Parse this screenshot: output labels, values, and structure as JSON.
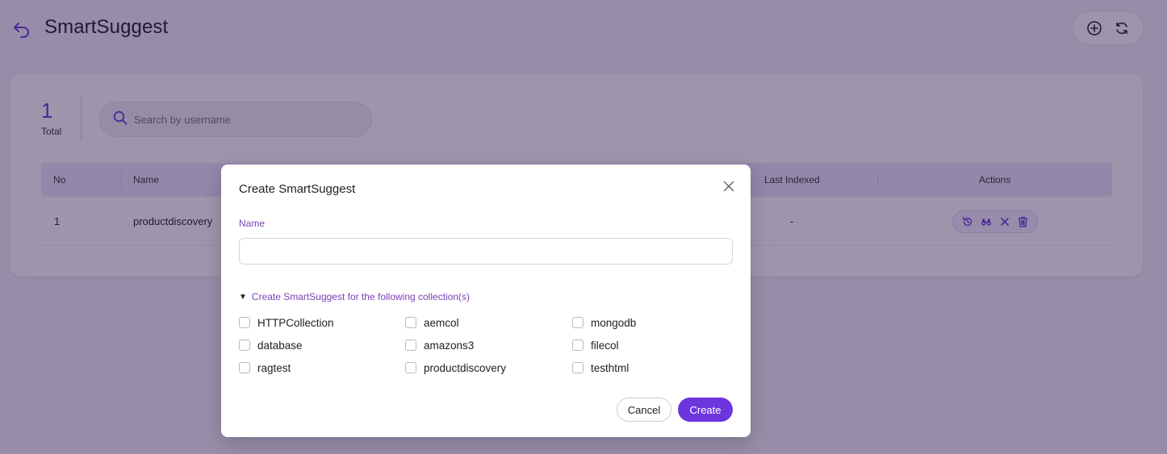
{
  "header": {
    "title": "SmartSuggest",
    "back_icon": "back-arrow-icon",
    "add_icon": "plus-circle-icon",
    "refresh_icon": "refresh-icon"
  },
  "summary": {
    "total_count": "1",
    "total_label": "Total"
  },
  "search": {
    "placeholder": "Search by username",
    "value": ""
  },
  "table": {
    "columns": [
      "No",
      "Name",
      "Last Indexed",
      "Actions"
    ],
    "rows": [
      {
        "no": "1",
        "name": "productdiscovery",
        "last_indexed": "-"
      }
    ],
    "row_action_icons": [
      "reindex-icon",
      "binoculars-icon",
      "close-icon",
      "trash-icon"
    ]
  },
  "modal": {
    "title": "Create SmartSuggest",
    "name_label": "Name",
    "name_value": "",
    "collections_toggle": "Create SmartSuggest for the following collection(s)",
    "collections": [
      {
        "label": "HTTPCollection",
        "checked": false
      },
      {
        "label": "aemcol",
        "checked": false
      },
      {
        "label": "mongodb",
        "checked": false
      },
      {
        "label": "database",
        "checked": false
      },
      {
        "label": "amazons3",
        "checked": false
      },
      {
        "label": "filecol",
        "checked": false
      },
      {
        "label": "ragtest",
        "checked": false
      },
      {
        "label": "productdiscovery",
        "checked": false
      },
      {
        "label": "testhtml",
        "checked": false
      }
    ],
    "cancel_label": "Cancel",
    "create_label": "Create"
  },
  "colors": {
    "accent": "#6d35dd",
    "label_purple": "#7a3fb4",
    "table_header_bg": "#ece6fb"
  }
}
